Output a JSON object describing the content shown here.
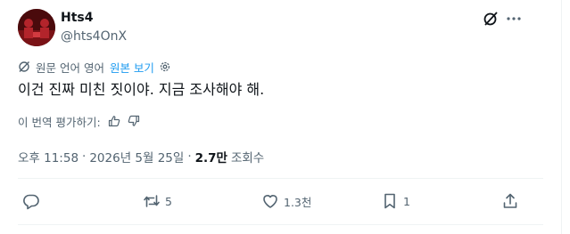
{
  "author": {
    "name": "Hts4",
    "handle": "@hts4OnX"
  },
  "translation": {
    "notice": "원문 언어 영어",
    "show_original": "원본 보기"
  },
  "tweet": {
    "text": "이건 진짜 미친 짓이야. 지금 조사해야 해."
  },
  "rating": {
    "prompt": "이 번역 평가하기:"
  },
  "meta": {
    "time": "오후 11:58",
    "date": "2026년 5월 25일",
    "views_count": "2.7만",
    "views_label": "조회수",
    "separator": "·"
  },
  "actions": {
    "replies": "",
    "reposts": "5",
    "likes": "1.3천",
    "bookmarks": "1"
  },
  "icons": [
    "grok-icon",
    "more-icon",
    "translate-icon",
    "settings-icon",
    "thumbs-up-icon",
    "thumbs-down-icon",
    "reply-icon",
    "repost-icon",
    "like-icon",
    "bookmark-icon",
    "share-icon"
  ],
  "colors": {
    "text": "#0f1419",
    "muted": "#536471",
    "link": "#1d9bf0",
    "divider": "#eff3f4"
  }
}
